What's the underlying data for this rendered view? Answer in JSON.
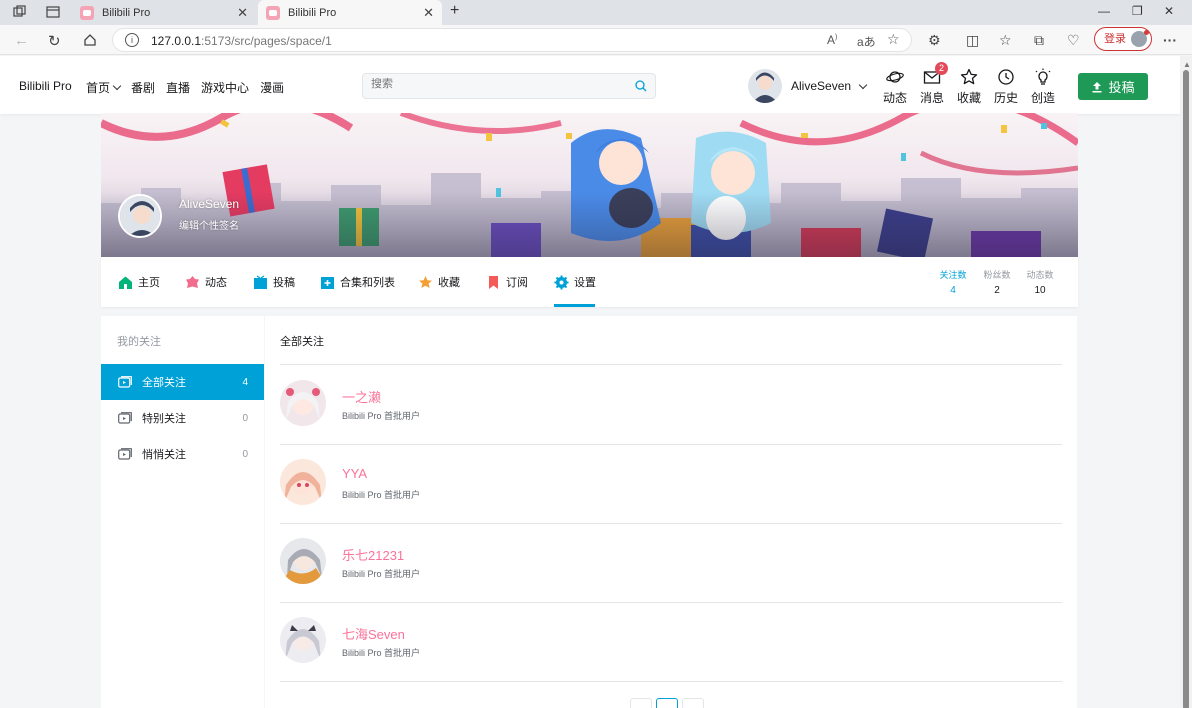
{
  "browser": {
    "tabs": [
      {
        "title": "Bilibili Pro"
      },
      {
        "title": "Bilibili Pro"
      }
    ],
    "url": {
      "host": "127.0.0.1",
      "path": ":5173/src/pages/space/1"
    },
    "login_label": "登录"
  },
  "header": {
    "logo": "Bilibili Pro",
    "nav": [
      "首页",
      "番剧",
      "直播",
      "游戏中心",
      "漫画"
    ],
    "search_placeholder": "搜索",
    "user_name": "AliveSeven",
    "tools": [
      {
        "label": "动态",
        "icon": "planet-icon"
      },
      {
        "label": "消息",
        "icon": "mail-icon",
        "badge": "2"
      },
      {
        "label": "收藏",
        "icon": "star-icon"
      },
      {
        "label": "历史",
        "icon": "clock-icon"
      },
      {
        "label": "创造",
        "icon": "bulb-icon"
      }
    ],
    "upload_label": "投稿"
  },
  "profile": {
    "name": "AliveSeven",
    "sign": "编辑个性签名"
  },
  "space_nav": {
    "items": [
      {
        "label": "主页",
        "icon": "home-icon",
        "color": "#00b47a"
      },
      {
        "label": "动态",
        "icon": "dynamic-icon",
        "color": "#f16c8d"
      },
      {
        "label": "投稿",
        "icon": "video-icon",
        "color": "#00a1d6"
      },
      {
        "label": "合集和列表",
        "icon": "collection-icon",
        "color": "#00a1d6"
      },
      {
        "label": "收藏",
        "icon": "star-icon",
        "color": "#f3a034"
      },
      {
        "label": "订阅",
        "icon": "bookmark-icon",
        "color": "#f45a5a"
      },
      {
        "label": "设置",
        "icon": "gear-icon",
        "color": "#00a1d6"
      }
    ],
    "stats": [
      {
        "label": "关注数",
        "value": "4"
      },
      {
        "label": "粉丝数",
        "value": "2"
      },
      {
        "label": "动态数",
        "value": "10"
      }
    ]
  },
  "sidebar": {
    "title": "我的关注",
    "items": [
      {
        "label": "全部关注",
        "count": "4"
      },
      {
        "label": "特别关注",
        "count": "0"
      },
      {
        "label": "悄悄关注",
        "count": "0"
      }
    ]
  },
  "main": {
    "title": "全部关注",
    "follows": [
      {
        "name": "一之濑",
        "desc": "Bilibili Pro 首批用户"
      },
      {
        "name": "YYA",
        "desc": "Bilibili Pro 首批用户"
      },
      {
        "name": "乐七21231",
        "desc": "Bilibili Pro 首批用户"
      },
      {
        "name": "七海Seven",
        "desc": "Bilibili Pro 首批用户"
      }
    ]
  },
  "colors": {
    "accent": "#00a1d6",
    "pink": "#fb7299",
    "upload_green": "#1e9956"
  }
}
